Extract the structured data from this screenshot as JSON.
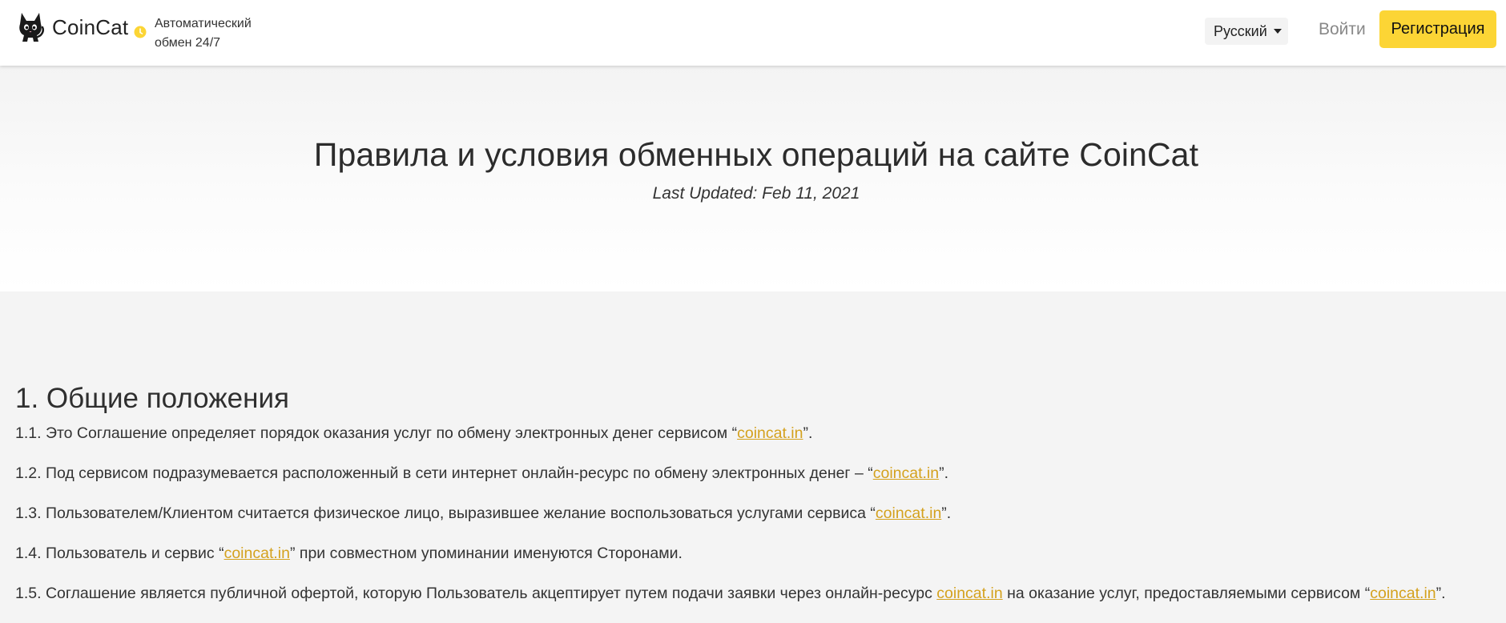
{
  "header": {
    "logo_text": "CoinCat",
    "tagline_line1": "Автоматический",
    "tagline_line2": "обмен 24/7",
    "language": "Русский",
    "login_label": "Войти",
    "register_label": "Регистрация",
    "accent_color": "#fcd535"
  },
  "hero": {
    "title": "Правила и условия обменных операций на сайте CoinCat",
    "subtitle": "Last Updated: Feb 11, 2021"
  },
  "content": {
    "section_title": "1. Общие положения",
    "link_text": "coincat.in",
    "link_color": "#d4a11d",
    "paragraphs": [
      {
        "before": "1.1. Это Соглашение определяет порядок оказания услуг по обмену электронных денег сервисом “",
        "after": "”."
      },
      {
        "before": "1.2. Под сервисом подразумевается расположенный в сети интернет онлайн-ресурс по обмену электронных денег – “",
        "after": "”."
      },
      {
        "before": "1.3. Пользователем/Клиентом считается физическое лицо, выразившее желание воспользоваться услугами сервиса “",
        "after": "”."
      },
      {
        "before": "1.4. Пользователь и сервис “",
        "after": "” при совместном упоминании именуются Сторонами."
      },
      {
        "before": "1.5. Соглашение является публичной офертой, которую Пользователь акцептирует путем подачи заявки через онлайн-ресурс ",
        "middle": " на оказание услуг, предоставляемыми сервисом “",
        "after": "”."
      }
    ]
  }
}
